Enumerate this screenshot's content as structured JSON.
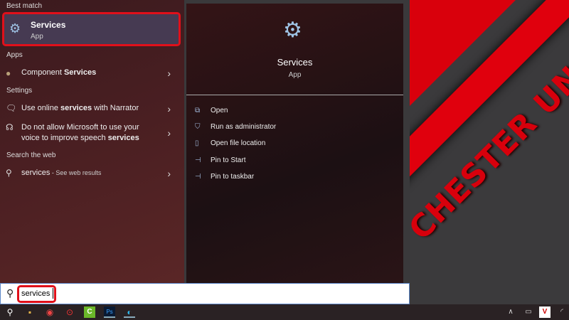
{
  "wallpaper": {
    "text": "CHESTER UN"
  },
  "best_match": {
    "heading": "Best match",
    "title": "Services",
    "subtitle": "App"
  },
  "apps": {
    "heading": "Apps",
    "items": [
      {
        "pre": "Component ",
        "bold": "Services",
        "post": ""
      }
    ]
  },
  "settings": {
    "heading": "Settings",
    "items": [
      {
        "pre": "Use online ",
        "bold": "services",
        "post": " with Narrator"
      },
      {
        "line1": "Do not allow Microsoft to use your",
        "pre": "voice to improve speech ",
        "bold": "services"
      }
    ]
  },
  "web": {
    "heading": "Search the web",
    "query": "services",
    "suffix": " - See web results"
  },
  "detail": {
    "title": "Services",
    "subtitle": "App",
    "actions": [
      "Open",
      "Run as administrator",
      "Open file location",
      "Pin to Start",
      "Pin to taskbar"
    ]
  },
  "search": {
    "value": "services"
  },
  "taskbar": {
    "tray_badge": "V"
  }
}
